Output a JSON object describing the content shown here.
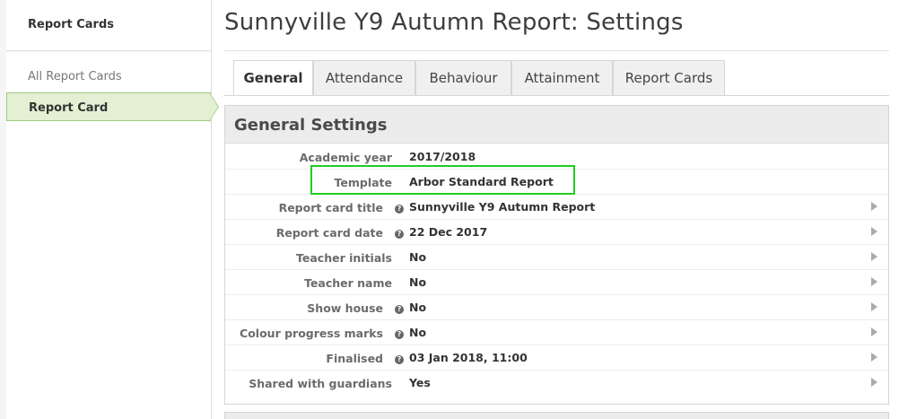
{
  "sidebar": {
    "header": "Report Cards",
    "items": [
      {
        "label": "All Report Cards"
      },
      {
        "label": "Report Card"
      }
    ]
  },
  "page_title": "Sunnyville Y9 Autumn Report: Settings",
  "tabs": [
    {
      "label": "General"
    },
    {
      "label": "Attendance"
    },
    {
      "label": "Behaviour"
    },
    {
      "label": "Attainment"
    },
    {
      "label": "Report Cards"
    }
  ],
  "panel": {
    "title": "General Settings",
    "rows": [
      {
        "label": "Academic year",
        "value": "2017/2018"
      },
      {
        "label": "Template",
        "value": "Arbor Standard Report"
      },
      {
        "label": "Report card title",
        "value": "Sunnyville Y9 Autumn Report"
      },
      {
        "label": "Report card date",
        "value": "22 Dec 2017"
      },
      {
        "label": "Teacher initials",
        "value": "No"
      },
      {
        "label": "Teacher name",
        "value": "No"
      },
      {
        "label": "Show house",
        "value": "No"
      },
      {
        "label": "Colour progress marks",
        "value": "No"
      },
      {
        "label": "Finalised",
        "value": "03 Jan 2018, 11:00"
      },
      {
        "label": "Shared with guardians",
        "value": "Yes"
      }
    ]
  },
  "colors": {
    "highlight": "#22cc22",
    "active_sidebar": "#e3f0d4"
  }
}
